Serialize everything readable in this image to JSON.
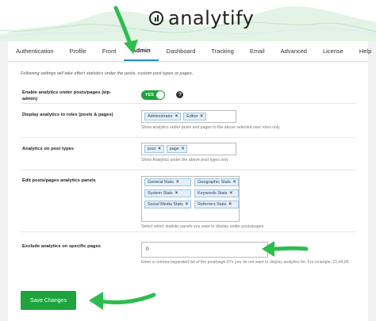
{
  "brand": {
    "name": "analytify",
    "logo_icon": "analytify-logo-icon"
  },
  "tabs": [
    {
      "label": "Authentication"
    },
    {
      "label": "Profile"
    },
    {
      "label": "Front"
    },
    {
      "label": "Admin",
      "active": true
    },
    {
      "label": "Dashboard"
    },
    {
      "label": "Tracking"
    },
    {
      "label": "Email"
    },
    {
      "label": "Advanced"
    },
    {
      "label": "License"
    },
    {
      "label": "Help"
    }
  ],
  "intro": "Following settings will take effect statistics under the posts, custom post types or pages.",
  "settings": {
    "enable": {
      "label": "Enable analytics under posts/pages (wp-admin)",
      "toggle_label": "YES",
      "toggle_on": true,
      "help_icon": "help-icon"
    },
    "roles": {
      "label": "Display analytics to roles (posts & pages)",
      "chips": [
        "Administrator",
        "Editor"
      ],
      "desc": "Show analytics under posts and pages to the above selected user roles only."
    },
    "post_types": {
      "label": "Analytics on post types",
      "chips": [
        "post",
        "page"
      ],
      "desc": "Show Analytics under the above post types only"
    },
    "panels": {
      "label": "Edit posts/pages analytics panels",
      "chips": [
        "General Stats",
        "Geographic Stats",
        "System Stats",
        "Keywords Stats",
        "Social Media Stats",
        "Referrers Stats"
      ],
      "desc": "Select which statistic panels you want to display under posts/pages."
    },
    "exclude": {
      "label": "Exclude analytics on specific pages",
      "value": "0",
      "desc": "Enter a comma-separated list of the post/page ID's you do not want to display analytics for. For example: 21,44,66"
    }
  },
  "save_label": "Save Changes",
  "colors": {
    "accent_green": "#1ea33d",
    "active_tab": "#1d8fd2",
    "arrow_green": "#2dbd4e"
  },
  "chip_remove_glyph": "×"
}
